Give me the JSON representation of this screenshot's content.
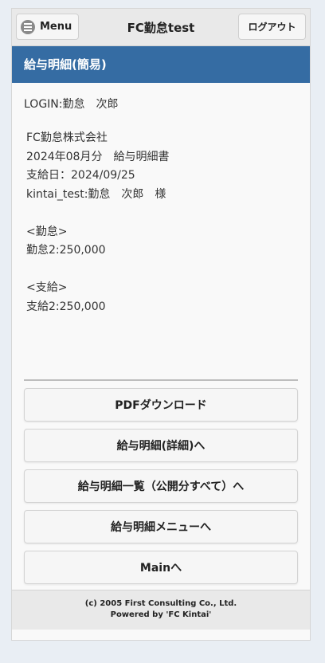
{
  "header": {
    "menu_label": "Menu",
    "title": "FC勤怠test",
    "logout_label": "ログアウト"
  },
  "page_title": "給与明細(簡易)",
  "login_line": "LOGIN:勤怠　次郎",
  "slip": {
    "lines": [
      "FC勤怠株式会社",
      "2024年08月分　給与明細書",
      "支給日：2024/09/25",
      "kintai_test:勤怠　次郎　様",
      "",
      "<勤怠>",
      "勤怠2:250,000",
      "",
      "<支給>",
      "支給2:250,000"
    ]
  },
  "actions": [
    {
      "label": "PDFダウンロード",
      "name": "pdf-download-button"
    },
    {
      "label": "給与明細(詳細)へ",
      "name": "payslip-detail-button"
    },
    {
      "label": "給与明細一覧（公開分すべて）へ",
      "name": "payslip-list-button"
    },
    {
      "label": "給与明細メニューへ",
      "name": "payslip-menu-button"
    },
    {
      "label": "Mainへ",
      "name": "main-button"
    }
  ],
  "footer": {
    "copyright": "(c) 2005 First Consulting Co., Ltd.",
    "powered_by": "Powered by 'FC Kintai'"
  },
  "colors": {
    "title_bar": "#356ca3",
    "background": "#e9eef4"
  }
}
